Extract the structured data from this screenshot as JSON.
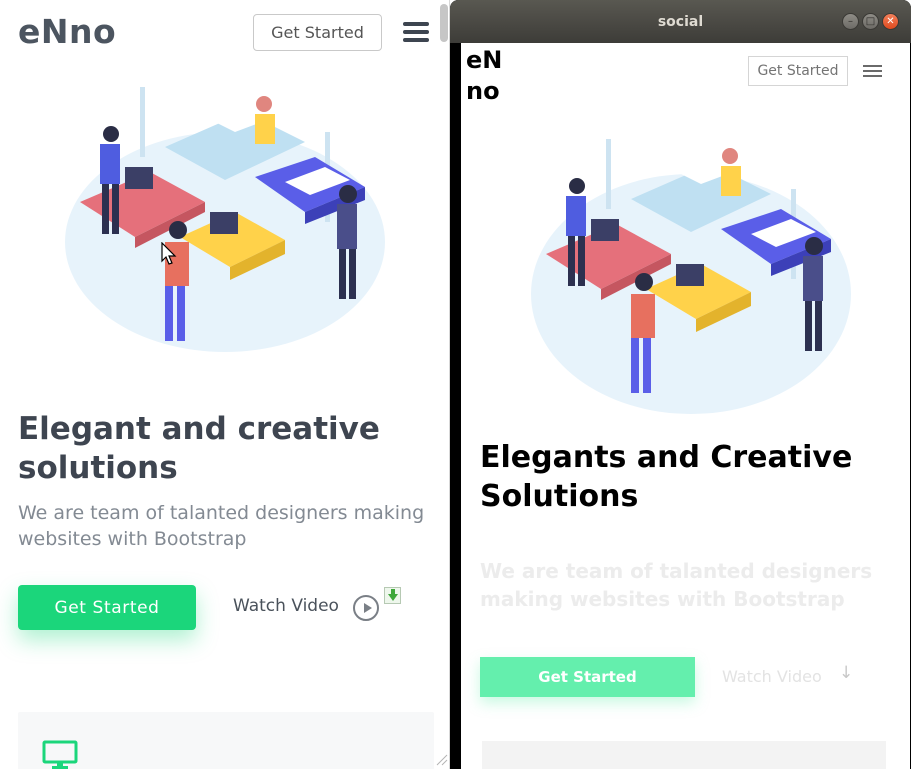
{
  "left_preview": {
    "logo": "eNno",
    "header_button": "Get Started",
    "hero_title": "Elegant and creative solutions",
    "hero_subtitle": "We are team of talanted designers making websites with Bootstrap",
    "cta_button": "Get Started",
    "watch_video": "Watch Video",
    "icons": {
      "menu": "hamburger-menu-icon",
      "play": "play-circle-icon",
      "download": "download-arrow-icon",
      "feature": "monitor-icon"
    },
    "colors": {
      "accent": "#1bd67b",
      "heading": "#3e4550",
      "text": "#838a93"
    }
  },
  "app_window": {
    "title": "social",
    "controls": [
      "minimize",
      "maximize",
      "close"
    ],
    "logo": "eNno",
    "header_button": "Get Started",
    "hero_title": "Elegants and Creative Solutions",
    "hero_subtitle": "We are team of talanted designers making websites with Bootstrap",
    "cta_button": "Get Started",
    "watch_video": "Watch Video",
    "watch_arrow": "↓",
    "colors": {
      "accent": "#64efad",
      "heading": "#000000",
      "faded_text": "#ececec"
    }
  }
}
